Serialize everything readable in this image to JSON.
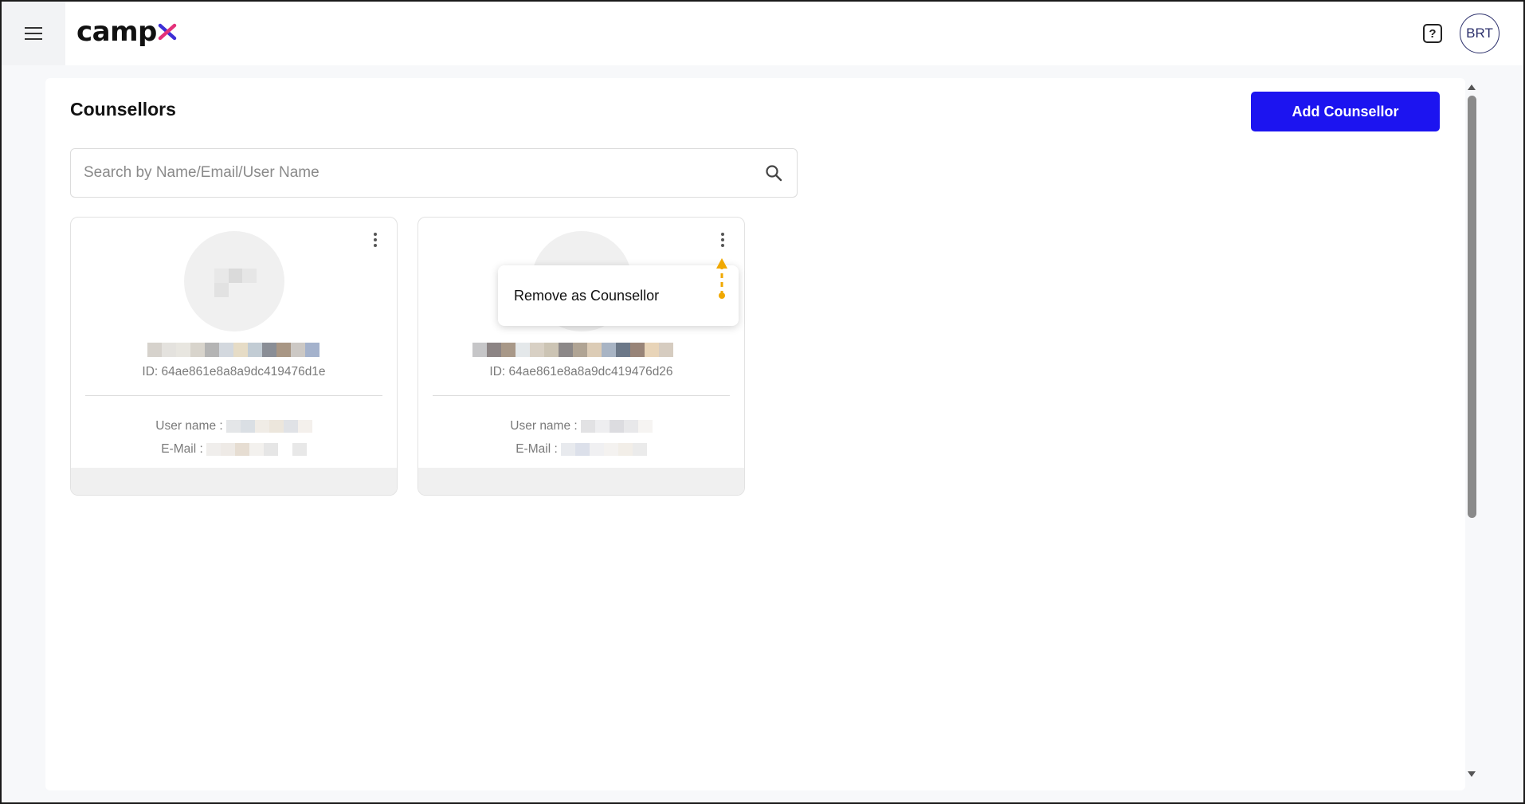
{
  "header": {
    "logo_text": "camp",
    "logo_x_colors": [
      "#e4317a",
      "#3d2fd6"
    ],
    "help_icon": "question-icon",
    "help_label": "?",
    "avatar_initials": "BRT"
  },
  "page": {
    "title": "Counsellors",
    "add_button_label": "Add Counsellor",
    "accent_color": "#1c14f0"
  },
  "search": {
    "placeholder": "Search by Name/Email/User Name",
    "value": "",
    "icon": "search-icon"
  },
  "cards": [
    {
      "id_label": "ID: 64ae861e8a8a9dc419476d1e",
      "username_label": "User name :",
      "email_label": "E-Mail :"
    },
    {
      "id_label": "ID: 64ae861e8a8a9dc419476d26",
      "username_label": "User name :",
      "email_label": "E-Mail :"
    }
  ],
  "dropdown": {
    "items": [
      "Remove as Counsellor"
    ]
  }
}
